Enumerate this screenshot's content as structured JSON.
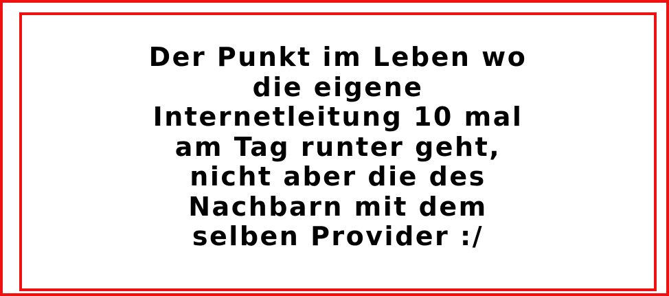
{
  "colors": {
    "border": "#ee1111",
    "background": "#ffffff",
    "text": "#000000"
  },
  "message": {
    "lines": [
      "Der Punkt im Leben wo",
      "die eigene",
      "Internetleitung 10 mal",
      "am Tag runter geht,",
      "nicht aber die des",
      "Nachbarn mit dem",
      "selben Provider :/"
    ]
  }
}
